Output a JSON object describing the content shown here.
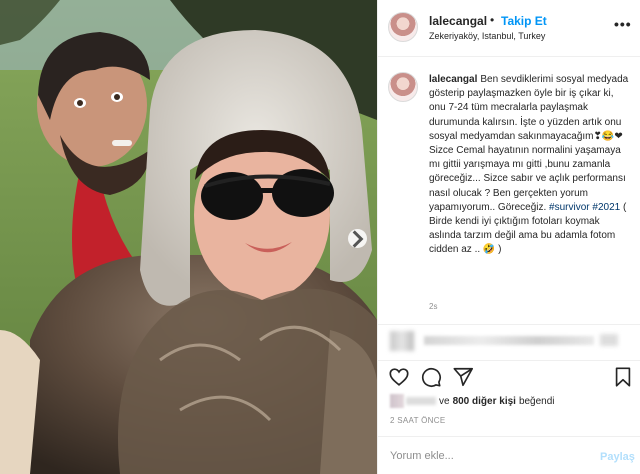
{
  "post": {
    "username": "lalecangal",
    "follow_label": "Takip Et",
    "separator": "•",
    "location": "Zekeriyaköy, Istanbul, Turkey",
    "more_icon": "more-horizontal-icon",
    "more_label": "•••"
  },
  "caption": {
    "username": "lalecangal",
    "text_1": "Ben sevdiklerimi sosyal medyada gösterip paylaşmazken öyle bir iş çıkar ki, onu 7-24 tüm mecralarla paylaşmak durumunda kalırsın. İşte o yüzden artık onu sosyal medyamdan sakınmayacağım",
    "emoji_1": "❣😂❤",
    "text_2": " Sizce Cemal hayatının normalini yaşamaya mı gittii yarışmaya mı gitti ,bunu zamanla göreceğiz... Sizce sabır ve açlık performansı nasıl olucak ? Ben gerçekten yorum yapamıyorum.. Göreceğiz. ",
    "hashtag_1": "#survivor",
    "hashtag_2": "#2021",
    "text_3": " ( Birde kendi iyi çıktığım fotoları koymak aslında tarzım değil ama bu adamla fotom cidden az .. ",
    "emoji_2": "🤣",
    "text_4": " )",
    "time": "2s"
  },
  "actions": {
    "like_icon": "heart-icon",
    "comment_icon": "comment-icon",
    "share_icon": "share-icon",
    "save_icon": "bookmark-icon"
  },
  "likes": {
    "prefix": "ve",
    "count_text": "800 diğer kişi",
    "suffix": "beğendi"
  },
  "timestamp": "2 SAAT ÖNCE",
  "comment": {
    "placeholder": "Yorum ekle...",
    "post_label": "Paylaş"
  },
  "colors": {
    "link_blue": "#0095f6",
    "hashtag_blue": "#00376b",
    "muted_gray": "#8e8e8e",
    "border": "#efefef"
  }
}
